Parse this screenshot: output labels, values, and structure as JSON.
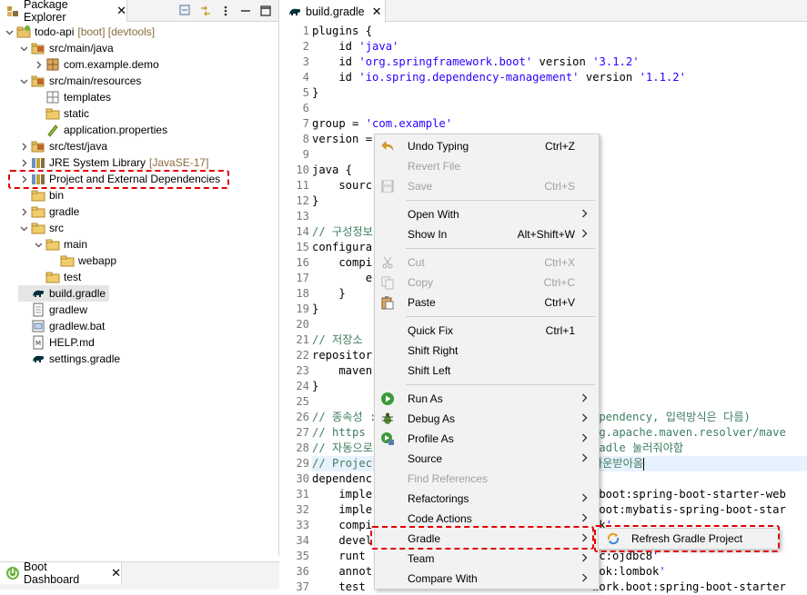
{
  "package_explorer": {
    "title": "Package Explorer",
    "close": "✕",
    "toolbar": [
      "collapse-all-icon",
      "link-with-editor-icon",
      "view-menu-icon",
      "minimize-icon",
      "maximize-icon"
    ],
    "tree": [
      {
        "label": "todo-api",
        "decor": "[boot] [devtools]",
        "icon": "project-icon",
        "twisty": "v",
        "indent": 0
      },
      {
        "label": "src/main/java",
        "icon": "source-folder-icon",
        "twisty": "v",
        "indent": 1
      },
      {
        "label": "com.example.demo",
        "icon": "package-icon",
        "twisty": ">",
        "indent": 2
      },
      {
        "label": "src/main/resources",
        "icon": "source-folder-icon",
        "twisty": "v",
        "indent": 1
      },
      {
        "label": "templates",
        "icon": "empty-package-icon",
        "twisty": "",
        "indent": 2
      },
      {
        "label": "static",
        "icon": "folder-icon",
        "twisty": "",
        "indent": 2
      },
      {
        "label": "application.properties",
        "icon": "properties-file-icon",
        "twisty": "",
        "indent": 2
      },
      {
        "label": "src/test/java",
        "icon": "source-folder-icon",
        "twisty": ">",
        "indent": 1
      },
      {
        "label": "JRE System Library",
        "decor": "[JavaSE-17]",
        "icon": "library-icon",
        "twisty": ">",
        "indent": 1
      },
      {
        "label": "Project and External Dependencies",
        "icon": "library-icon",
        "twisty": ">",
        "indent": 1
      },
      {
        "label": "bin",
        "icon": "folder-icon",
        "twisty": "",
        "indent": 1
      },
      {
        "label": "gradle",
        "icon": "folder-icon",
        "twisty": ">",
        "indent": 1
      },
      {
        "label": "src",
        "icon": "folder-icon",
        "twisty": "v",
        "indent": 1
      },
      {
        "label": "main",
        "icon": "folder-icon",
        "twisty": "v",
        "indent": 2
      },
      {
        "label": "webapp",
        "icon": "folder-icon",
        "twisty": "",
        "indent": 3
      },
      {
        "label": "test",
        "icon": "folder-icon",
        "twisty": "",
        "indent": 2
      },
      {
        "label": "build.gradle",
        "icon": "gradle-file-icon",
        "twisty": "",
        "indent": 1,
        "selected": true
      },
      {
        "label": "gradlew",
        "icon": "text-file-icon",
        "twisty": "",
        "indent": 1
      },
      {
        "label": "gradlew.bat",
        "icon": "batch-file-icon",
        "twisty": "",
        "indent": 1
      },
      {
        "label": "HELP.md",
        "icon": "markdown-file-icon",
        "twisty": "",
        "indent": 1
      },
      {
        "label": "settings.gradle",
        "icon": "gradle-file-icon",
        "twisty": "",
        "indent": 1
      }
    ]
  },
  "boot_dashboard": {
    "title": "Boot Dashboard",
    "close": "✕"
  },
  "editor": {
    "tab_title": "build.gradle",
    "close": "✕",
    "lines": [
      {
        "n": "1",
        "text": "plugins {"
      },
      {
        "n": "2",
        "text": "    id 'java'"
      },
      {
        "n": "3",
        "text": "    id 'org.springframework.boot' version '3.1.2'"
      },
      {
        "n": "4",
        "text": "    id 'io.spring.dependency-management' version '1.1.2'"
      },
      {
        "n": "5",
        "text": "}"
      },
      {
        "n": "6",
        "text": ""
      },
      {
        "n": "7",
        "text": "group = 'com.example'"
      },
      {
        "n": "8",
        "text": "version ="
      },
      {
        "n": "9",
        "text": ""
      },
      {
        "n": "10",
        "text": "java {"
      },
      {
        "n": "11",
        "text": "    sourc"
      },
      {
        "n": "12",
        "text": "}"
      },
      {
        "n": "13",
        "text": ""
      },
      {
        "n": "14",
        "text": "// 구성정보"
      },
      {
        "n": "15",
        "text": "configura"
      },
      {
        "n": "16",
        "text": "    compi"
      },
      {
        "n": "17",
        "text": "        e"
      },
      {
        "n": "18",
        "text": "    }"
      },
      {
        "n": "19",
        "text": "}"
      },
      {
        "n": "20",
        "text": ""
      },
      {
        "n": "21",
        "text": "// 저장소"
      },
      {
        "n": "22",
        "text": "repositor"
      },
      {
        "n": "23",
        "text": "    maven"
      },
      {
        "n": "24",
        "text": "}"
      },
      {
        "n": "25",
        "text": ""
      },
      {
        "n": "26",
        "text": "// 종속성 :"
      },
      {
        "n": "27",
        "text": "// https"
      },
      {
        "n": "28",
        "text": "// 자동으로"
      },
      {
        "n": "29",
        "text": "// Projec"
      },
      {
        "n": "30",
        "text": "dependenc"
      },
      {
        "n": "31",
        "text": "    imple"
      },
      {
        "n": "32",
        "text": "    imple"
      },
      {
        "n": "33",
        "text": "    compi"
      },
      {
        "n": "34",
        "text": "    devel"
      },
      {
        "n": "35",
        "text": "    runt"
      },
      {
        "n": "36",
        "text": "    annot"
      },
      {
        "n": "37",
        "text": "    test"
      }
    ],
    "right_fragments": [
      {
        "line": 26,
        "text": "ependency, 입력방식은 다름)"
      },
      {
        "line": 27,
        "text": "rg.apache.maven.resolver/mave"
      },
      {
        "line": 28,
        "text": "radle 눌러줘야함"
      },
      {
        "line": 29,
        "text": "다운받아옴"
      },
      {
        "line": 31,
        "text": ".boot:spring-boot-starter-web"
      },
      {
        "line": 32,
        "text": "boot:mybatis-spring-boot-star"
      },
      {
        "line": 33,
        "text": "ok'"
      },
      {
        "line": 34,
        "text": "ls'"
      },
      {
        "line": 35,
        "text": "oc:ojdbc8'"
      },
      {
        "line": 36,
        "text": "bok:lombok'"
      },
      {
        "line": 37,
        "text": "work.boot:spring-boot-starter"
      }
    ]
  },
  "context_menu": {
    "items": [
      {
        "label": "Undo Typing",
        "shortcut": "Ctrl+Z",
        "icon": "undo-icon",
        "enabled": true
      },
      {
        "label": "Revert File",
        "shortcut": "",
        "icon": "",
        "enabled": false
      },
      {
        "label": "Save",
        "shortcut": "Ctrl+S",
        "icon": "save-icon",
        "enabled": false
      },
      {
        "sep": true
      },
      {
        "label": "Open With",
        "shortcut": "",
        "icon": "",
        "enabled": true,
        "submenu": true
      },
      {
        "label": "Show In",
        "shortcut": "Alt+Shift+W",
        "icon": "",
        "enabled": true,
        "submenu": true
      },
      {
        "sep": true
      },
      {
        "label": "Cut",
        "shortcut": "Ctrl+X",
        "icon": "cut-icon",
        "enabled": false
      },
      {
        "label": "Copy",
        "shortcut": "Ctrl+C",
        "icon": "copy-icon",
        "enabled": false
      },
      {
        "label": "Paste",
        "shortcut": "Ctrl+V",
        "icon": "paste-icon",
        "enabled": true
      },
      {
        "sep": true
      },
      {
        "label": "Quick Fix",
        "shortcut": "Ctrl+1",
        "icon": "",
        "enabled": true
      },
      {
        "label": "Shift Right",
        "shortcut": "",
        "icon": "",
        "enabled": true
      },
      {
        "label": "Shift Left",
        "shortcut": "",
        "icon": "",
        "enabled": true
      },
      {
        "sep": true
      },
      {
        "label": "Run As",
        "shortcut": "",
        "icon": "run-icon",
        "enabled": true,
        "submenu": true
      },
      {
        "label": "Debug As",
        "shortcut": "",
        "icon": "debug-icon",
        "enabled": true,
        "submenu": true
      },
      {
        "label": "Profile As",
        "shortcut": "",
        "icon": "profile-icon",
        "enabled": true,
        "submenu": true
      },
      {
        "label": "Source",
        "shortcut": "",
        "icon": "",
        "enabled": true,
        "submenu": true
      },
      {
        "label": "Find References",
        "shortcut": "",
        "icon": "",
        "enabled": false
      },
      {
        "label": "Refactorings",
        "shortcut": "",
        "icon": "",
        "enabled": true,
        "submenu": true
      },
      {
        "label": "Code Actions",
        "shortcut": "",
        "icon": "",
        "enabled": true,
        "submenu": true
      },
      {
        "label": "Gradle",
        "shortcut": "",
        "icon": "",
        "enabled": true,
        "submenu": true
      },
      {
        "label": "Team",
        "shortcut": "",
        "icon": "",
        "enabled": true,
        "submenu": true
      },
      {
        "label": "Compare With",
        "shortcut": "",
        "icon": "",
        "enabled": true,
        "submenu": true
      }
    ],
    "submenu_arrow": ">"
  },
  "gradle_submenu": {
    "label": "Refresh Gradle Project",
    "icon": "refresh-gradle-icon"
  },
  "colors": {
    "highlight": "#e00000",
    "string": "#2a00ff",
    "comment": "#3f7f5f"
  }
}
